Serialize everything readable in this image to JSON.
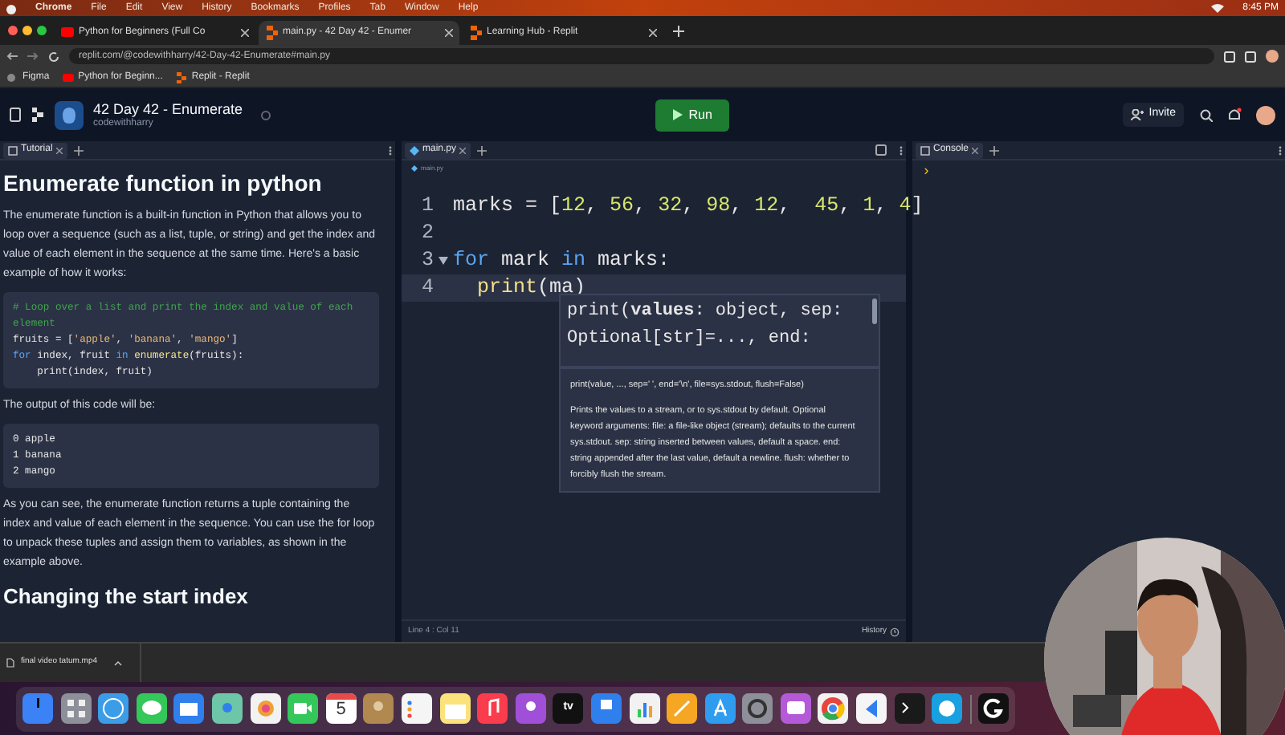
{
  "menu_bar": {
    "items": [
      "Chrome",
      "File",
      "Edit",
      "View",
      "History",
      "Bookmarks",
      "Profiles",
      "Tab",
      "Window",
      "Help"
    ],
    "clock": "8:45 PM"
  },
  "browser_tabs": [
    {
      "label": "Python for Beginners (Full Co",
      "selected": false,
      "kind": "video"
    },
    {
      "label": "main.py - 42 Day 42 - Enumer",
      "selected": true,
      "kind": "replit"
    },
    {
      "label": "Learning Hub - Replit",
      "selected": false,
      "kind": "replit"
    }
  ],
  "address_bar": {
    "url": "replit.com/@codewithharry/42-Day-42-Enumerate#main.py"
  },
  "bookmarks": [
    {
      "label": "Figma",
      "kind": "plain"
    },
    {
      "label": "Python for Beginn...",
      "kind": "video"
    },
    {
      "label": "Replit - Replit",
      "kind": "replit"
    }
  ],
  "repl_header": {
    "title": "42 Day 42 - Enumerate",
    "owner": "codewithharry",
    "run_button": "Run",
    "invite_button": "Invite"
  },
  "tutorial": {
    "tab": "Tutorial",
    "heading": "Enumerate function in python",
    "blocks": [
      {
        "kind": "paragraph",
        "text": "The enumerate function is a built-in function in Python that allows you to loop over a sequence (such as a list, tuple, or string) and get the index and value of each element in the sequence at the same time. Here's a basic example of how it works:"
      },
      {
        "kind": "code",
        "lines": [
          [
            {
              "text": "# Loop over a list and print the index and value of each element",
              "kind": "comment"
            }
          ],
          [
            {
              "text": "fruits = [",
              "kind": "plain"
            },
            {
              "text": "'apple'",
              "kind": "str"
            },
            {
              "text": ", ",
              "kind": "plain"
            },
            {
              "text": "'banana'",
              "kind": "str"
            },
            {
              "text": ", ",
              "kind": "plain"
            },
            {
              "text": "'mango'",
              "kind": "str"
            },
            {
              "text": "]",
              "kind": "plain"
            }
          ],
          [
            {
              "text": "for",
              "kind": "kw"
            },
            {
              "text": " index, fruit ",
              "kind": "plain"
            },
            {
              "text": "in",
              "kind": "kw"
            },
            {
              "text": " enumerate",
              "kind": "fn"
            },
            {
              "text": "(fruits):",
              "kind": "plain"
            }
          ],
          [
            {
              "text": "    print(index, fruit)",
              "kind": "plain"
            }
          ]
        ]
      },
      {
        "kind": "paragraph",
        "text": "The output of this code will be:"
      },
      {
        "kind": "code",
        "lines": [
          [
            {
              "text": "0 apple",
              "kind": "plain"
            }
          ],
          [
            {
              "text": "1 banana",
              "kind": "plain"
            }
          ],
          [
            {
              "text": "2 mango",
              "kind": "plain"
            }
          ]
        ]
      },
      {
        "kind": "paragraph",
        "text": "As you can see, the enumerate function returns a tuple containing the index and value of each element in the sequence. You can use the for loop to unpack these tuples and assign them to variables, as shown in the example above."
      },
      {
        "kind": "heading",
        "text": "Changing the start index"
      }
    ]
  },
  "editor": {
    "tab": "main.py",
    "breadcrumb": "main.py",
    "lines": [
      {
        "number": "1",
        "tokens": [
          {
            "text": "marks = [",
            "kind": "plain"
          },
          {
            "text": "12",
            "kind": "num"
          },
          {
            "text": ", ",
            "kind": "plain"
          },
          {
            "text": "56",
            "kind": "num"
          },
          {
            "text": ", ",
            "kind": "plain"
          },
          {
            "text": "32",
            "kind": "num"
          },
          {
            "text": ", ",
            "kind": "plain"
          },
          {
            "text": "98",
            "kind": "num"
          },
          {
            "text": ", ",
            "kind": "plain"
          },
          {
            "text": "12",
            "kind": "num"
          },
          {
            "text": ",  ",
            "kind": "plain"
          },
          {
            "text": "45",
            "kind": "num"
          },
          {
            "text": ", ",
            "kind": "plain"
          },
          {
            "text": "1",
            "kind": "num"
          },
          {
            "text": ", ",
            "kind": "plain"
          },
          {
            "text": "4",
            "kind": "num"
          },
          {
            "text": "]",
            "kind": "plain"
          }
        ]
      },
      {
        "number": "2"
      },
      {
        "number": "3",
        "fold": true,
        "tokens": [
          {
            "text": "for",
            "kind": "kw"
          },
          {
            "text": " mark ",
            "kind": "plain"
          },
          {
            "text": "in",
            "kind": "kw"
          },
          {
            "text": " marks:",
            "kind": "plain"
          }
        ]
      },
      {
        "number": "4",
        "current": true,
        "tokens": [
          {
            "text": "  print",
            "kind": "fn"
          },
          {
            "text": "(ma)",
            "kind": "plain"
          }
        ]
      }
    ],
    "signature_help": {
      "lines": [
        "print(**values**: object, sep:",
        "Optional[str]=..., end:"
      ],
      "signature": "print(value, ..., sep=' ', end='\\n', file=sys.stdout, flush=False)",
      "description": "Prints the values to a stream, or to sys.stdout by default. Optional keyword arguments: file:  a file-like object (stream); defaults to the current sys.stdout. sep:   string inserted between values, default a space. end:   string appended after the last value, default a newline. flush: whether to forcibly flush the stream."
    },
    "status": "Line 4 : Col 11",
    "history": "History"
  },
  "console": {
    "tab": "Console",
    "prompt": "›"
  },
  "download_bar": {
    "file": "final video tatum.mp4"
  },
  "dock": {
    "calendar_day": "5",
    "tv_label": "tv"
  }
}
